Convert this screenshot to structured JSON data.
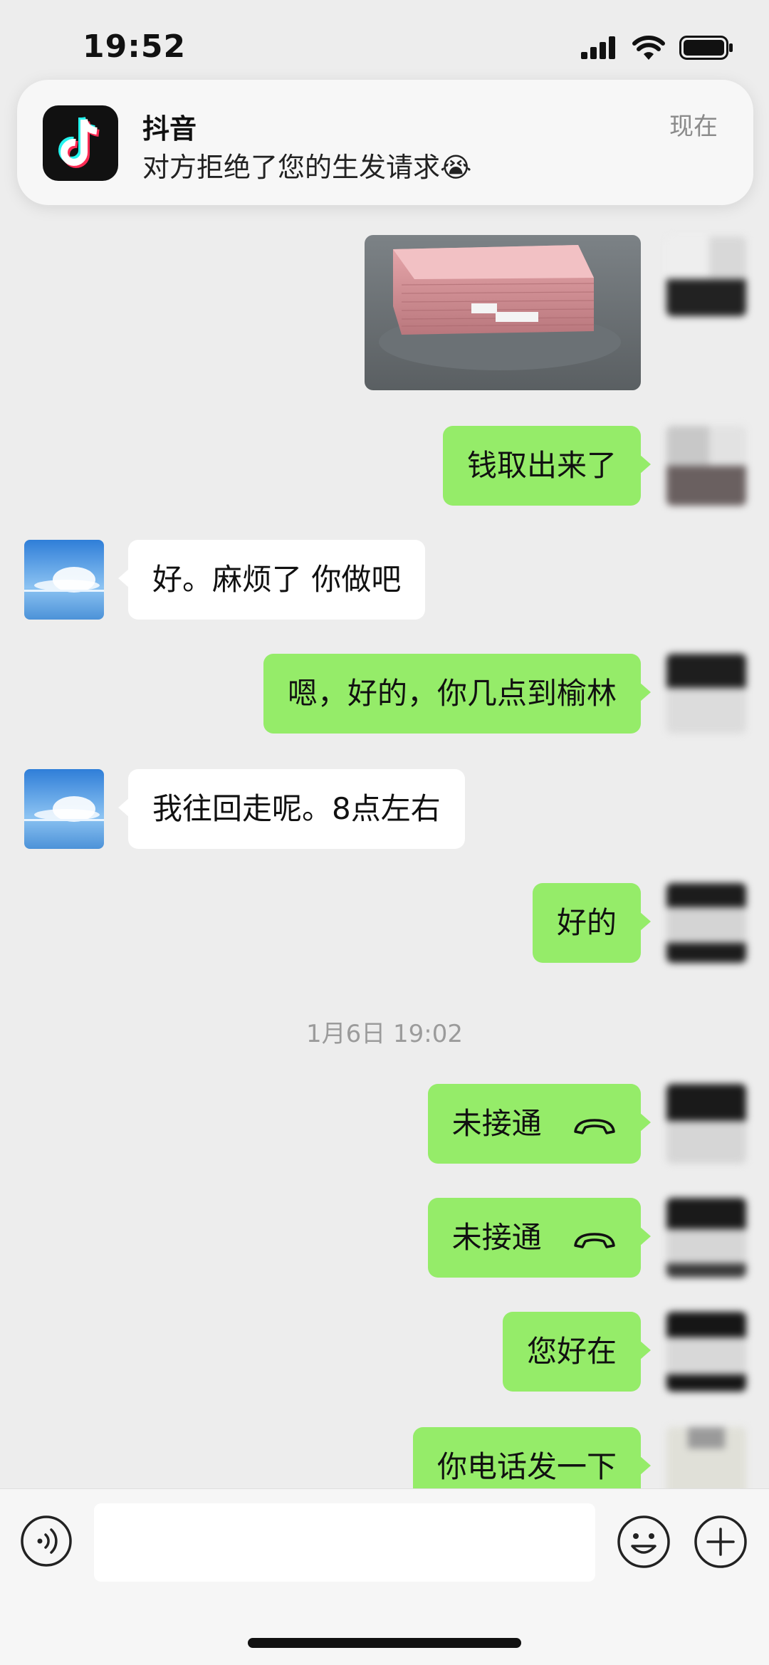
{
  "status_bar": {
    "time": "19:52"
  },
  "notification": {
    "app_name": "抖音",
    "message": "对方拒绝了您的生发请求😭",
    "time": "现在"
  },
  "messages": {
    "m1": "钱取出来了",
    "m2": "好。麻烦了 你做吧",
    "m3": "嗯，好的，你几点到榆林",
    "m4": "我往回走呢。8点左右",
    "m5": "好的",
    "m6": "未接通",
    "m7": "未接通",
    "m8": "您好在",
    "m9": "你电话发一下"
  },
  "timestamp": "1月6日 19:02"
}
